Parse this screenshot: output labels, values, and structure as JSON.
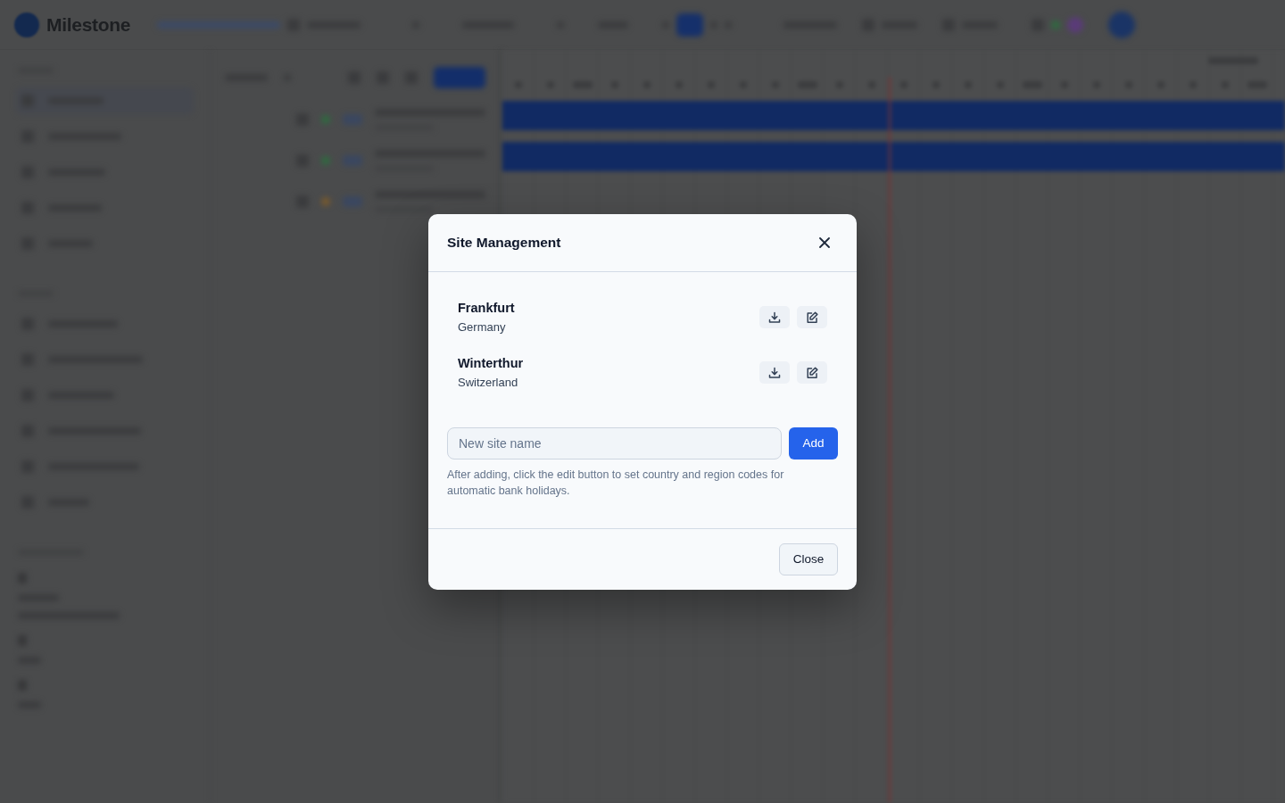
{
  "app": {
    "logo_text": "Milestone"
  },
  "dialog": {
    "title": "Site Management",
    "sites": [
      {
        "name": "Frankfurt",
        "country": "Germany"
      },
      {
        "name": "Winterthur",
        "country": "Switzerland"
      }
    ],
    "new_site_field": {
      "placeholder": "New site name"
    },
    "add_button": "Add",
    "hint": "After adding, click the edit button to set country and region codes for automatic bank holidays.",
    "close_button": "Close"
  }
}
